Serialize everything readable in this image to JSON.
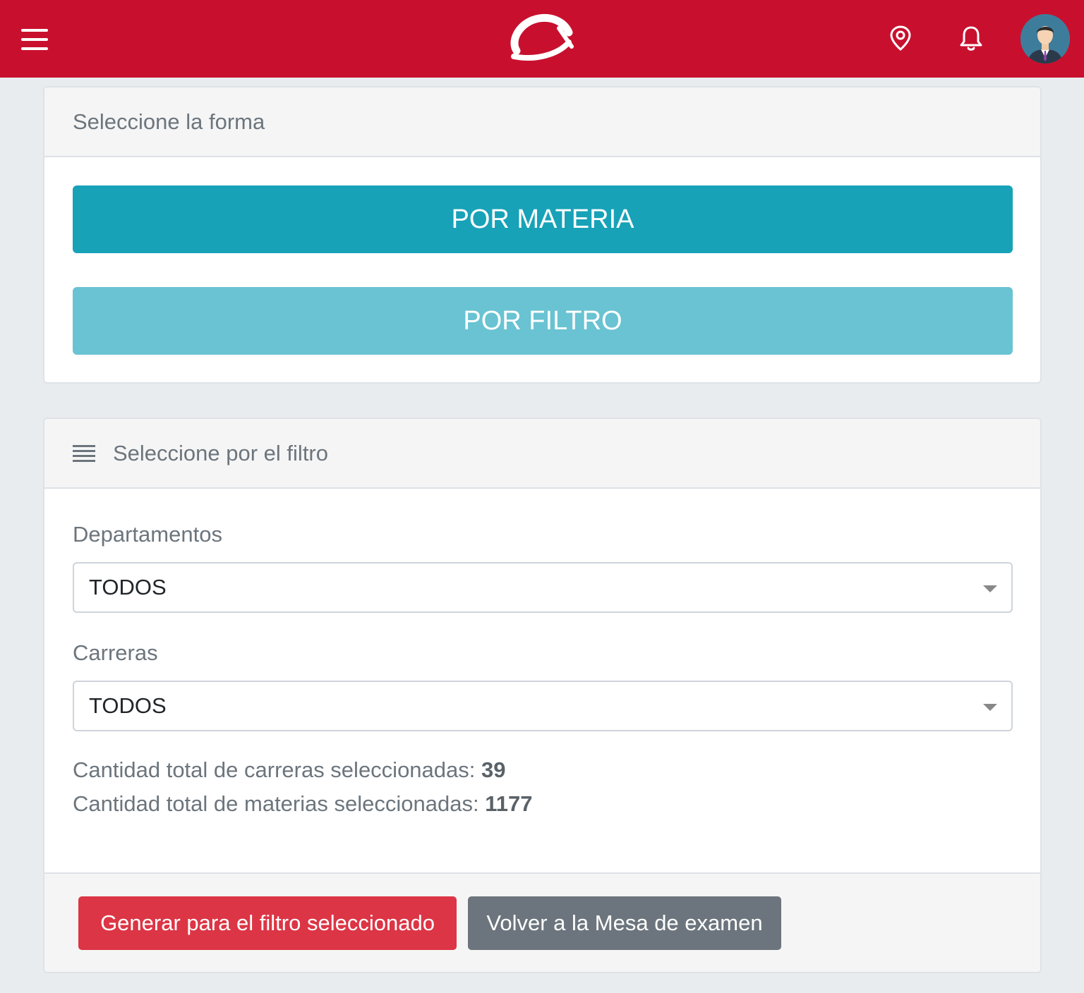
{
  "topbar": {
    "menu_icon": "hamburger-menu-icon",
    "logo": "brand-logo",
    "location_icon": "map-pin-icon",
    "notifications_icon": "bell-icon",
    "avatar": "user-avatar",
    "background_color": "#c8102e"
  },
  "forma_card": {
    "header": "Seleccione la forma",
    "btn_materia": "POR MATERIA",
    "btn_filtro": "POR FILTRO"
  },
  "filtro_card": {
    "header": "Seleccione por el filtro",
    "header_icon": "list-icon",
    "departamentos_label": "Departamentos",
    "departamentos_value": "TODOS",
    "carreras_label": "Carreras",
    "carreras_value": "TODOS",
    "stat_carreras_label": "Cantidad total de carreras seleccionadas:",
    "stat_carreras_value": "39",
    "stat_materias_label": "Cantidad total de materias seleccionadas:",
    "stat_materias_value": "1177",
    "btn_generar": "Generar para el filtro seleccionado",
    "btn_volver": "Volver a la Mesa de examen"
  },
  "colors": {
    "primary_info": "#17a2b8",
    "info_light": "#69c3d2",
    "danger": "#dc3545",
    "secondary": "#6c757d"
  }
}
